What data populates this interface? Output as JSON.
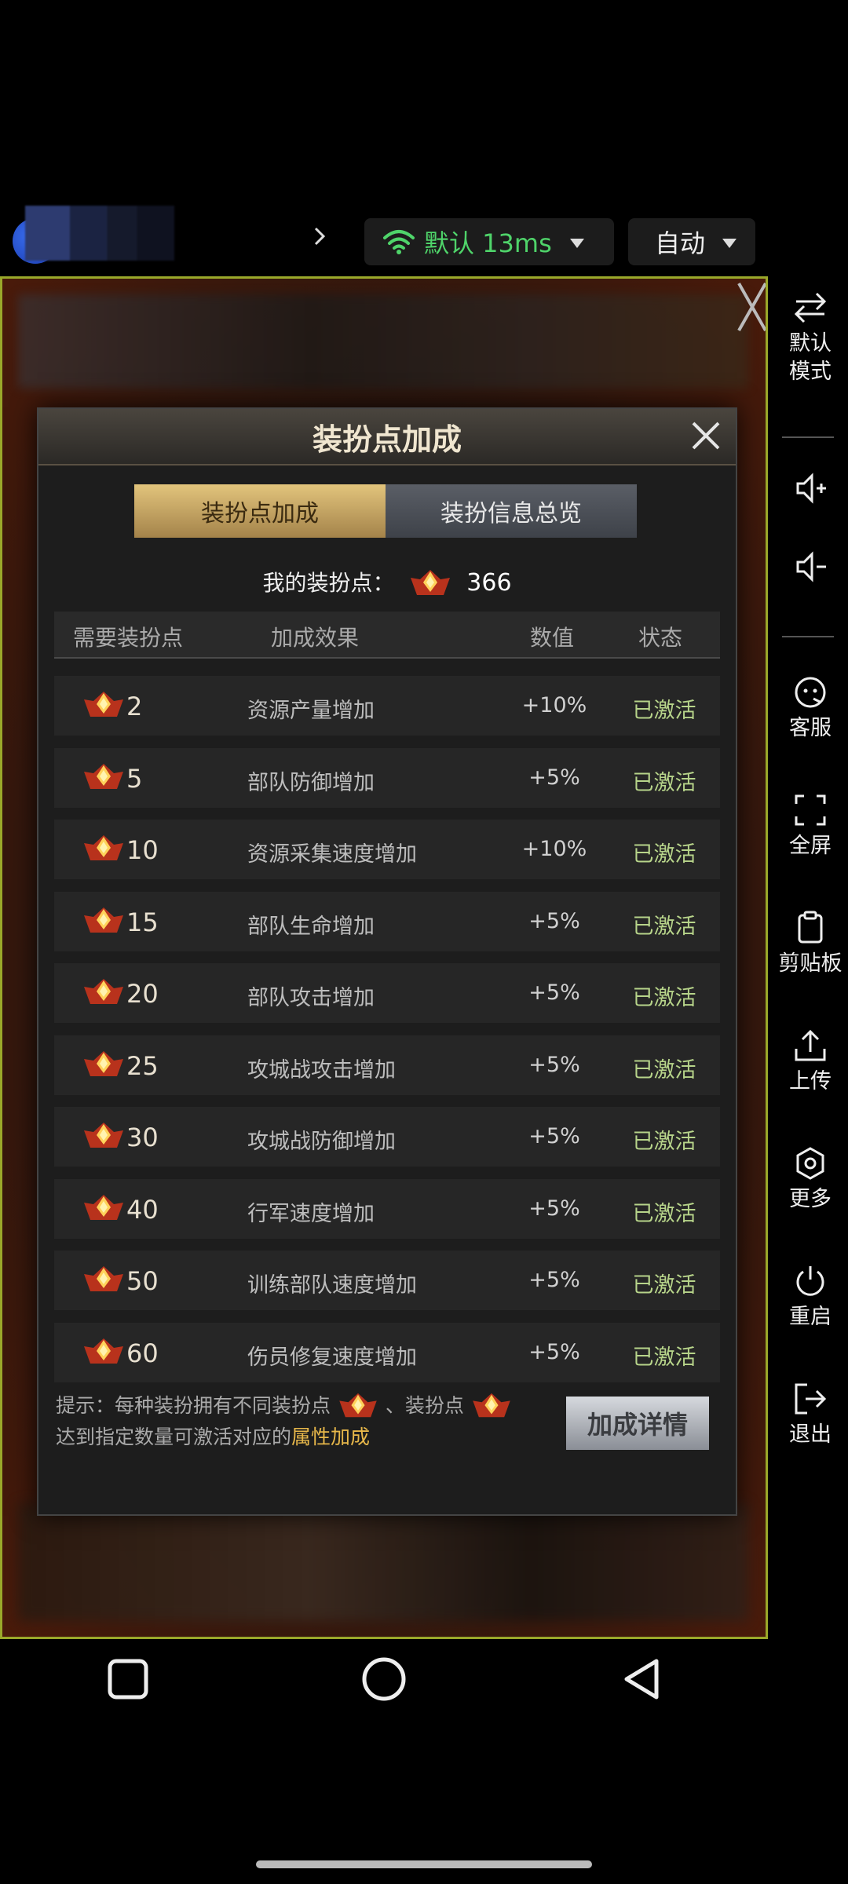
{
  "topbar": {
    "network_label": "默认 13ms",
    "mode_label": "自动"
  },
  "modal": {
    "title": "装扮点加成",
    "tabs": [
      {
        "label": "装扮点加成",
        "active": true
      },
      {
        "label": "装扮信息总览",
        "active": false
      }
    ],
    "my_points_label": "我的装扮点：",
    "my_points_value": "366",
    "headers": [
      "需要装扮点",
      "加成效果",
      "数值",
      "状态"
    ],
    "rows": [
      {
        "points": "2",
        "effect": "资源产量增加",
        "value": "+10%",
        "status": "已激活"
      },
      {
        "points": "5",
        "effect": "部队防御增加",
        "value": "+5%",
        "status": "已激活"
      },
      {
        "points": "10",
        "effect": "资源采集速度增加",
        "value": "+10%",
        "status": "已激活"
      },
      {
        "points": "15",
        "effect": "部队生命增加",
        "value": "+5%",
        "status": "已激活"
      },
      {
        "points": "20",
        "effect": "部队攻击增加",
        "value": "+5%",
        "status": "已激活"
      },
      {
        "points": "25",
        "effect": "攻城战攻击增加",
        "value": "+5%",
        "status": "已激活"
      },
      {
        "points": "30",
        "effect": "攻城战防御增加",
        "value": "+5%",
        "status": "已激活"
      },
      {
        "points": "40",
        "effect": "行军速度增加",
        "value": "+5%",
        "status": "已激活"
      },
      {
        "points": "50",
        "effect": "训练部队速度增加",
        "value": "+5%",
        "status": "已激活"
      },
      {
        "points": "60",
        "effect": "伤员修复速度增加",
        "value": "+5%",
        "status": "已激活"
      }
    ],
    "tip_prefix": "提示：每种装扮拥有不同装扮点",
    "tip_mid": "、装扮点",
    "tip_line2": "达到指定数量可激活对应的",
    "tip_highlight": "属性加成",
    "detail_button": "加成详情"
  },
  "side_panel": [
    {
      "icon": "swap-icon",
      "label": "默认\n模式"
    },
    {
      "icon": "volume-up-icon",
      "label": ""
    },
    {
      "icon": "volume-down-icon",
      "label": ""
    },
    {
      "icon": "support-icon",
      "label": "客服"
    },
    {
      "icon": "fullscreen-icon",
      "label": "全屏"
    },
    {
      "icon": "clipboard-icon",
      "label": "剪贴板"
    },
    {
      "icon": "upload-icon",
      "label": "上传"
    },
    {
      "icon": "settings-icon",
      "label": "更多"
    },
    {
      "icon": "power-icon",
      "label": "重启"
    },
    {
      "icon": "exit-icon",
      "label": "退出"
    }
  ],
  "colors": {
    "network_green": "#4fd46a",
    "status_green": "#b7d48a",
    "gold": "#e8b84a",
    "game_border": "#9aa82a"
  }
}
